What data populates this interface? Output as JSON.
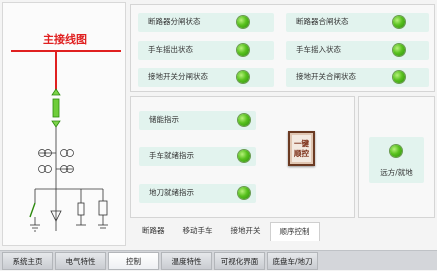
{
  "diagram": {
    "title": "主接线图"
  },
  "top_status": [
    {
      "label": "断路器分闸状态",
      "state": "on"
    },
    {
      "label": "断路器合闸状态",
      "state": "on"
    },
    {
      "label": "手车摇出状态",
      "state": "on"
    },
    {
      "label": "手车摇入状态",
      "state": "on"
    },
    {
      "label": "接地开关分闸状态",
      "state": "on"
    },
    {
      "label": "接地开关合闸状态",
      "state": "on"
    }
  ],
  "mid_status": [
    {
      "label": "储能指示",
      "state": "on"
    },
    {
      "label": "手车就绪指示",
      "state": "on"
    },
    {
      "label": "地刀就绪指示",
      "state": "on"
    }
  ],
  "action_button": {
    "line1": "一键",
    "line2": "顺控"
  },
  "mode": {
    "label": "远方/就地",
    "state": "on"
  },
  "subtabs": [
    "断路器",
    "移动手车",
    "接地开关",
    "顺序控制"
  ],
  "active_subtab": "顺序控制",
  "navtabs": [
    "系统主页",
    "电气特性",
    "控制",
    "温度特性",
    "可视化界面",
    "底盘车/地刀"
  ],
  "active_navtab": "控制",
  "colors": {
    "led_green": "#58c11e",
    "status_bg": "#e2f3ee",
    "busbar_red": "#e02020",
    "button_brown": "#b06a4a"
  }
}
